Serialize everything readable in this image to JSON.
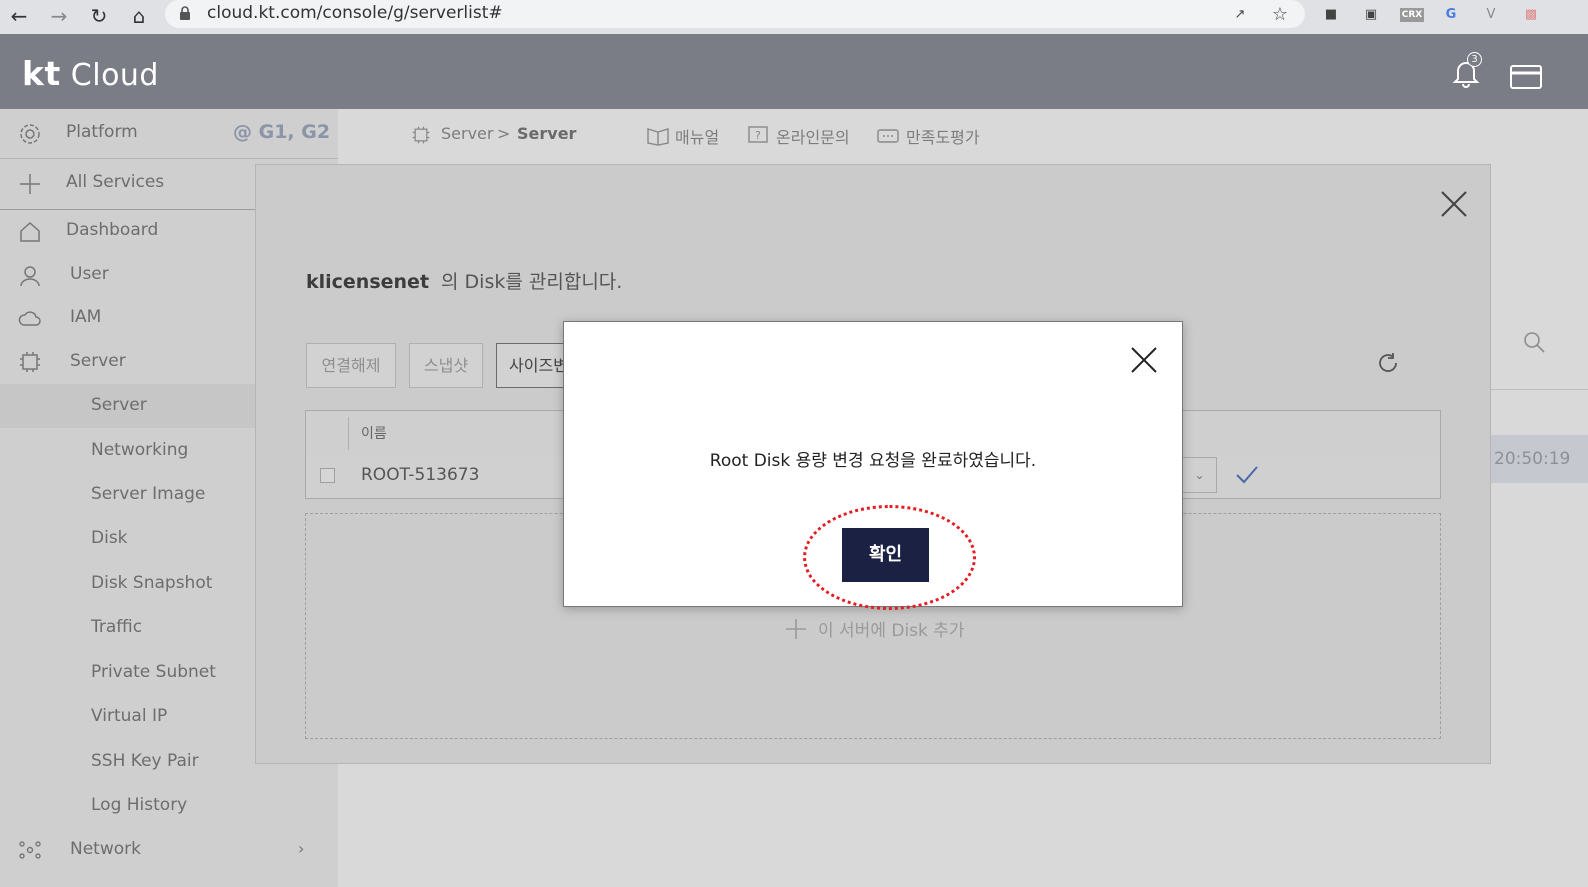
{
  "browser": {
    "url": "cloud.kt.com/console/g/serverlist#",
    "extensions": [
      "CRX"
    ]
  },
  "header": {
    "logo_bold": "kt",
    "logo_text": "Cloud",
    "notification_count": "3"
  },
  "sidebar": {
    "platform_label": "Platform",
    "region": "@ G1, G2",
    "all_services": "All Services",
    "items": [
      {
        "label": "Dashboard"
      },
      {
        "label": "User"
      },
      {
        "label": "IAM"
      },
      {
        "label": "Server"
      }
    ],
    "server_sub": [
      {
        "label": "Server"
      },
      {
        "label": "Networking"
      },
      {
        "label": "Server Image"
      },
      {
        "label": "Disk"
      },
      {
        "label": "Disk Snapshot"
      },
      {
        "label": "Traffic"
      },
      {
        "label": "Private Subnet"
      },
      {
        "label": "Virtual IP"
      },
      {
        "label": "SSH Key Pair"
      },
      {
        "label": "Log History"
      }
    ],
    "network": "Network"
  },
  "breadcrumb": {
    "level1": "Server",
    "separator": ">",
    "level2": "Server"
  },
  "top_links": {
    "manual": "매뉴얼",
    "inquiry": "온라인문의",
    "survey": "만족도평가"
  },
  "disk_modal": {
    "server_name": "klicensenet",
    "title_suffix": "의 Disk를 관리합니다.",
    "buttons": {
      "disconnect": "연결해제",
      "snapshot": "스냅샷",
      "resize": "사이즈변"
    },
    "table": {
      "col_name": "이름",
      "rows": [
        {
          "name": "ROOT-513673"
        }
      ]
    },
    "add_disk": "이 서버에 Disk 추가"
  },
  "background": {
    "time": "20:50:19"
  },
  "confirm_dialog": {
    "message": "Root Disk 용량 변경 요청을 완료하였습니다.",
    "ok_label": "확인"
  },
  "colors": {
    "header_bg": "#7a7c86",
    "ok_button": "#1b2143",
    "highlight": "#e51c23"
  }
}
